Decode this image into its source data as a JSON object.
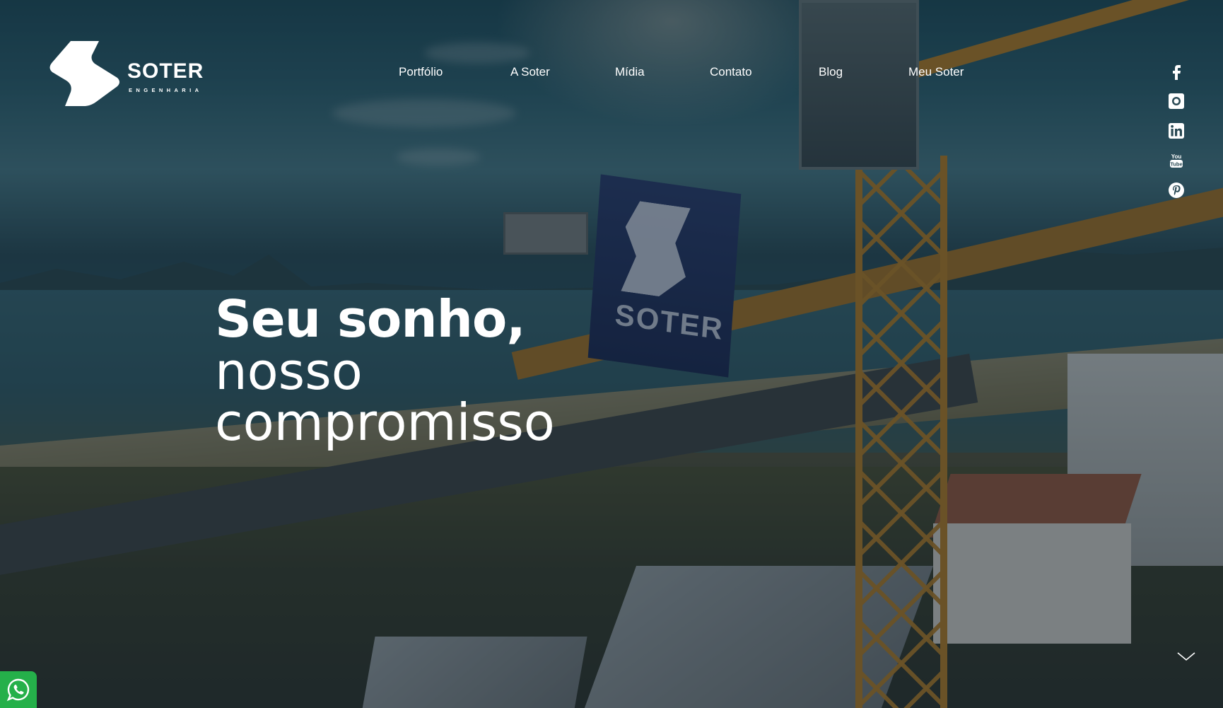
{
  "brand": {
    "name": "SOTER",
    "subtitle": "ENGENHARIA"
  },
  "nav": {
    "items": [
      {
        "label": "Portfólio"
      },
      {
        "label": "A Soter"
      },
      {
        "label": "Mídia"
      },
      {
        "label": "Contato"
      },
      {
        "label": "Blog"
      },
      {
        "label": "Meu Soter"
      }
    ]
  },
  "social": [
    "facebook-icon",
    "instagram-icon",
    "linkedin-icon",
    "youtube-icon",
    "pinterest-icon"
  ],
  "hero": {
    "headline_bold": "Seu sonho,",
    "headline_line2": "nosso",
    "headline_line3": "compromisso",
    "flag_text": "SOTER"
  },
  "colors": {
    "text": "#ffffff",
    "whatsapp": "#25b04a",
    "crane": "#b8822a",
    "flag": "#1d2c57"
  }
}
